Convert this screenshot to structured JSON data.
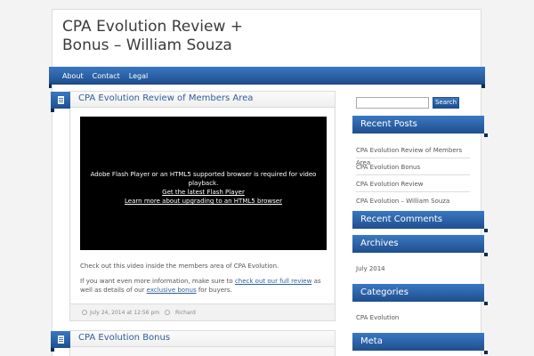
{
  "site": {
    "title_line1": "CPA Evolution Review +",
    "title_line2": "Bonus – William Souza"
  },
  "nav": {
    "items": [
      {
        "label": "About"
      },
      {
        "label": "Contact"
      },
      {
        "label": "Legal"
      }
    ]
  },
  "posts": [
    {
      "title": "CPA Evolution Review of Members Area",
      "video": {
        "message": "Adobe Flash Player or an HTML5 supported browser is required for video playback.",
        "link1": "Get the latest Flash Player",
        "link2": "Learn more about upgrading to an HTML5 browser"
      },
      "para1": "Check out this video inside the members area of CPA Evolution.",
      "para2_part1": "If you want even more information, make sure to ",
      "para2_link1": "check out our full review",
      "para2_part2": " as well as details of our ",
      "para2_link2": "exclusive bonus",
      "para2_part3": " for buyers.",
      "date": "July 24, 2014 at 12:56 pm",
      "author": "Richard"
    },
    {
      "title": "CPA Evolution Bonus"
    }
  ],
  "sidebar": {
    "search_button": "Search",
    "search_value": "",
    "recent_posts_title": "Recent Posts",
    "recent_posts": [
      {
        "label": "CPA Evolution Review of Members Area"
      },
      {
        "label": "CPA Evolution Bonus"
      },
      {
        "label": "CPA Evolution Review"
      },
      {
        "label": "CPA Evolution – William Souza"
      }
    ],
    "recent_comments_title": "Recent Comments",
    "archives_title": "Archives",
    "archive_item": "July 2014",
    "categories_title": "Categories",
    "category_item": "CPA Evolution",
    "meta_title": "Meta"
  },
  "colors": {
    "accent": "#2f68b0",
    "accent_dark": "#1f4f8e",
    "link": "#2f5e99"
  }
}
